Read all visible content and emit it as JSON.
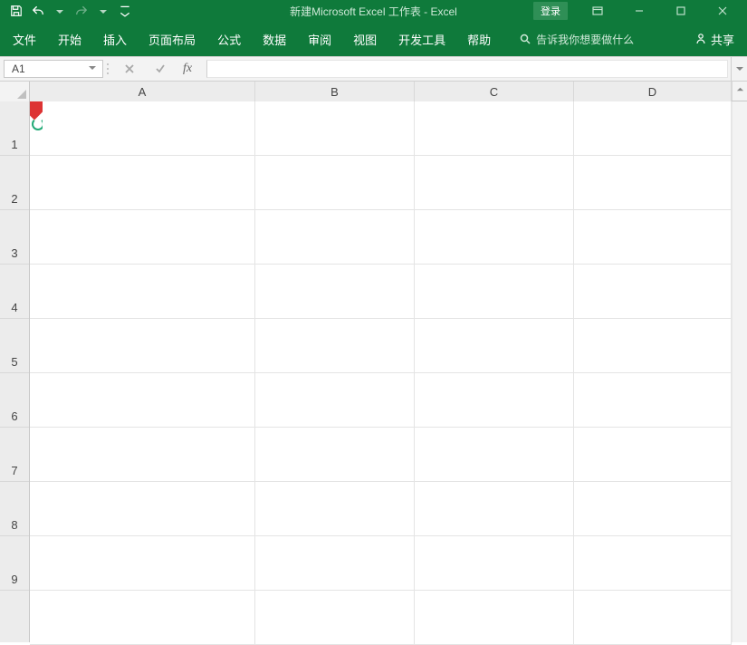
{
  "titlebar": {
    "title": "新建Microsoft Excel 工作表  -  Excel",
    "login": "登录"
  },
  "ribbon": {
    "tabs": [
      "文件",
      "开始",
      "插入",
      "页面布局",
      "公式",
      "数据",
      "审阅",
      "视图",
      "开发工具",
      "帮助"
    ],
    "tellme": "告诉我你想要做什么",
    "share": "共享"
  },
  "formula_bar": {
    "name_box": "A1",
    "fx_label": "fx",
    "formula": ""
  },
  "grid": {
    "columns": [
      "A",
      "B",
      "C",
      "D"
    ],
    "rows": [
      "1",
      "2",
      "3",
      "4",
      "5",
      "6",
      "7",
      "8",
      "9"
    ]
  }
}
